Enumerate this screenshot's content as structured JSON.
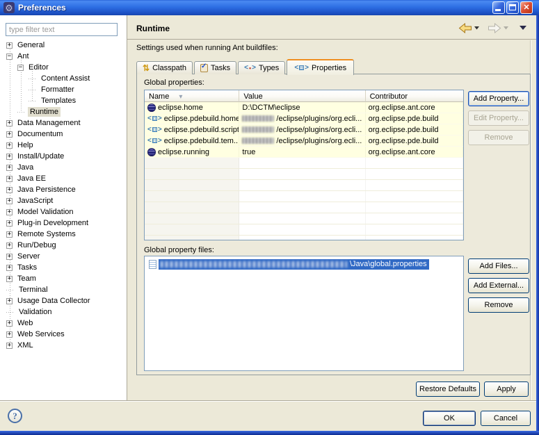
{
  "window": {
    "title": "Preferences"
  },
  "icons": {
    "gear_glyph": "⚙",
    "close_glyph": "✕",
    "help_glyph": "?",
    "expander_plus": "+",
    "expander_minus": "−",
    "sort_glyph": "▾",
    "classpath_glyph": "⇅",
    "tasks_check_glyph": "✓",
    "types_dot_glyph": "•",
    "bracket_left": "<",
    "bracket_right": ">"
  },
  "sidebar": {
    "filter_placeholder": "type filter text",
    "tree": [
      {
        "label": "General",
        "level": 0,
        "expander": "plus",
        "selected": false
      },
      {
        "label": "Ant",
        "level": 0,
        "expander": "minus",
        "selected": false
      },
      {
        "label": "Editor",
        "level": 1,
        "expander": "minus",
        "selected": false
      },
      {
        "label": "Content Assist",
        "level": 2,
        "expander": "none",
        "selected": false
      },
      {
        "label": "Formatter",
        "level": 2,
        "expander": "none",
        "selected": false
      },
      {
        "label": "Templates",
        "level": 2,
        "expander": "none",
        "selected": false
      },
      {
        "label": "Runtime",
        "level": 1,
        "expander": "none",
        "selected": true
      },
      {
        "label": "Data Management",
        "level": 0,
        "expander": "plus",
        "selected": false
      },
      {
        "label": "Documentum",
        "level": 0,
        "expander": "plus",
        "selected": false
      },
      {
        "label": "Help",
        "level": 0,
        "expander": "plus",
        "selected": false
      },
      {
        "label": "Install/Update",
        "level": 0,
        "expander": "plus",
        "selected": false
      },
      {
        "label": "Java",
        "level": 0,
        "expander": "plus",
        "selected": false
      },
      {
        "label": "Java EE",
        "level": 0,
        "expander": "plus",
        "selected": false
      },
      {
        "label": "Java Persistence",
        "level": 0,
        "expander": "plus",
        "selected": false
      },
      {
        "label": "JavaScript",
        "level": 0,
        "expander": "plus",
        "selected": false
      },
      {
        "label": "Model Validation",
        "level": 0,
        "expander": "plus",
        "selected": false
      },
      {
        "label": "Plug-in Development",
        "level": 0,
        "expander": "plus",
        "selected": false
      },
      {
        "label": "Remote Systems",
        "level": 0,
        "expander": "plus",
        "selected": false
      },
      {
        "label": "Run/Debug",
        "level": 0,
        "expander": "plus",
        "selected": false
      },
      {
        "label": "Server",
        "level": 0,
        "expander": "plus",
        "selected": false
      },
      {
        "label": "Tasks",
        "level": 0,
        "expander": "plus",
        "selected": false
      },
      {
        "label": "Team",
        "level": 0,
        "expander": "plus",
        "selected": false
      },
      {
        "label": "Terminal",
        "level": 0,
        "expander": "none",
        "selected": false
      },
      {
        "label": "Usage Data Collector",
        "level": 0,
        "expander": "plus",
        "selected": false
      },
      {
        "label": "Validation",
        "level": 0,
        "expander": "none",
        "selected": false
      },
      {
        "label": "Web",
        "level": 0,
        "expander": "plus",
        "selected": false
      },
      {
        "label": "Web Services",
        "level": 0,
        "expander": "plus",
        "selected": false
      },
      {
        "label": "XML",
        "level": 0,
        "expander": "plus",
        "selected": false
      }
    ]
  },
  "header": {
    "title": "Runtime"
  },
  "content": {
    "description": "Settings used when running Ant buildfiles:",
    "tabs": [
      {
        "label": "Classpath",
        "icon": "classpath-icon",
        "selected": false
      },
      {
        "label": "Tasks",
        "icon": "tasks-icon",
        "selected": false
      },
      {
        "label": "Types",
        "icon": "types-icon",
        "selected": false
      },
      {
        "label": "Properties",
        "icon": "properties-icon",
        "selected": true
      }
    ],
    "properties": {
      "label": "Global properties:",
      "columns": [
        "Name",
        "Value",
        "Contributor"
      ],
      "sort_column": "Name",
      "sort_indicator": "▾",
      "rows": [
        {
          "icon": "eclipse-icon",
          "name": "eclipse.home",
          "value": "D:\\DCTM\\eclipse",
          "redacted": false,
          "contributor": "org.eclipse.ant.core"
        },
        {
          "icon": "property-icon",
          "name": "eclipse.pdebuild.home",
          "value": "/eclipse/plugins/org.ecli...",
          "redacted": true,
          "contributor": "org.eclipse.pde.build"
        },
        {
          "icon": "property-icon",
          "name": "eclipse.pdebuild.scripts",
          "value": "/eclipse/plugins/org.ecli...",
          "redacted": true,
          "contributor": "org.eclipse.pde.build"
        },
        {
          "icon": "property-icon",
          "name": "eclipse.pdebuild.tem...",
          "value": "/eclipse/plugins/org.ecli...",
          "redacted": true,
          "contributor": "org.eclipse.pde.build"
        },
        {
          "icon": "eclipse-icon",
          "name": "eclipse.running",
          "value": "true",
          "redacted": false,
          "contributor": "org.eclipse.ant.core"
        }
      ],
      "buttons": [
        {
          "label": "Add Property...",
          "enabled": true,
          "focused": true
        },
        {
          "label": "Edit Property...",
          "enabled": false,
          "focused": false
        },
        {
          "label": "Remove",
          "enabled": false,
          "focused": false
        }
      ]
    },
    "files": {
      "label": "Global property files:",
      "items": [
        {
          "icon": "file-icon",
          "redacted_prefix": true,
          "visible_text": "\\Java\\global.properties",
          "selected": true
        }
      ],
      "buttons": [
        {
          "label": "Add Files...",
          "enabled": true
        },
        {
          "label": "Add External...",
          "enabled": true
        },
        {
          "label": "Remove",
          "enabled": true
        }
      ]
    },
    "footer_buttons": [
      {
        "label": "Restore Defaults"
      },
      {
        "label": "Apply"
      }
    ]
  },
  "dialog": {
    "ok_label": "OK",
    "cancel_label": "Cancel"
  }
}
